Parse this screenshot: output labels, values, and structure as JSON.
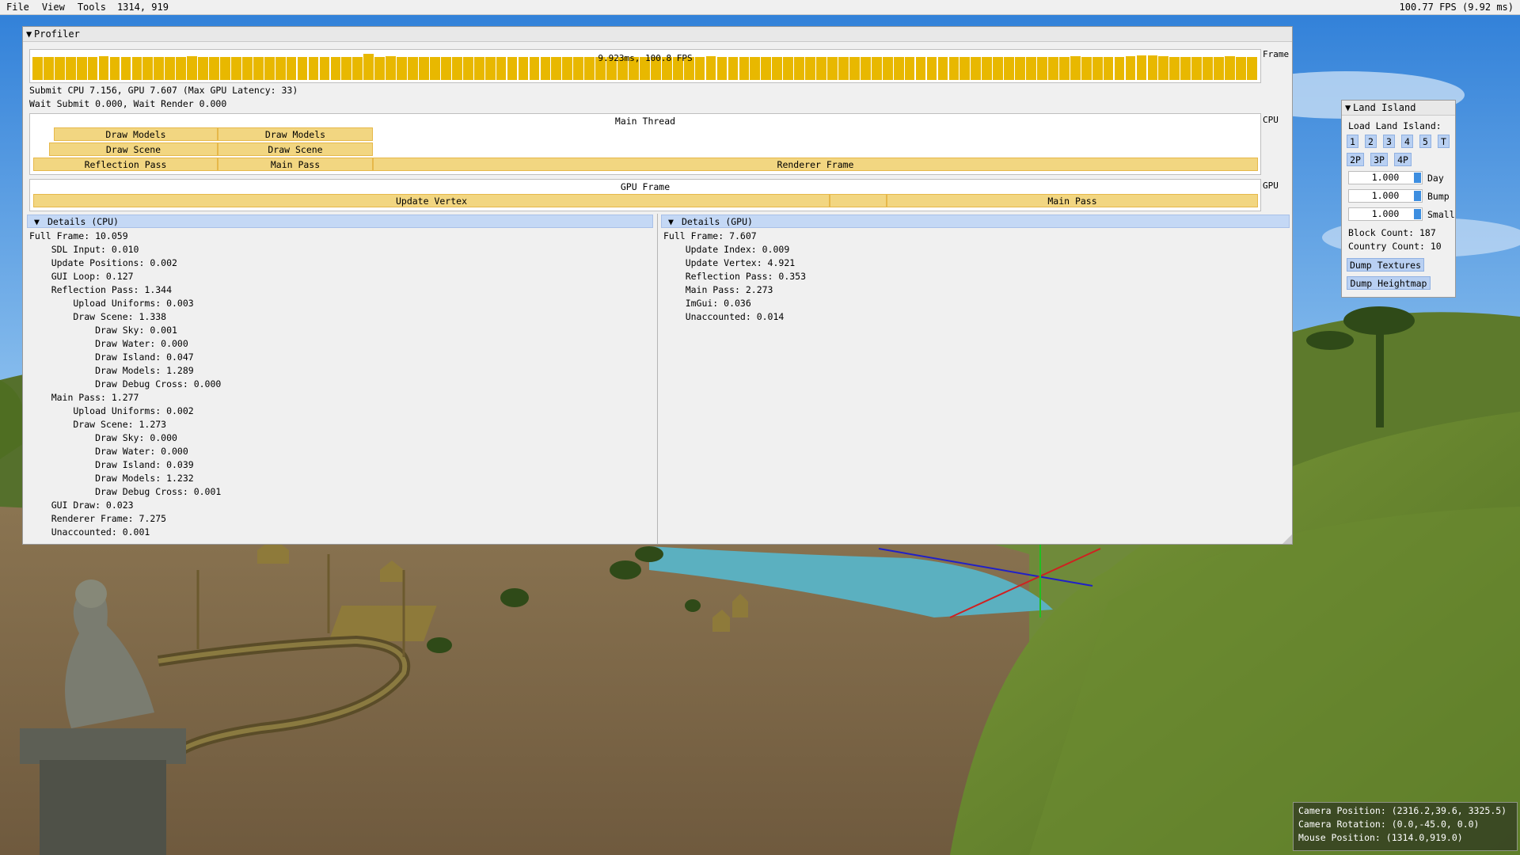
{
  "menu": {
    "items": [
      "File",
      "View",
      "Tools"
    ],
    "mouse_coord": "1314, 919",
    "fps": "100.77 FPS (9.92 ms)"
  },
  "profiler": {
    "title": "Profiler",
    "frame_graph": {
      "label": "9.923ms, 100.8 FPS",
      "side_label": "Frame",
      "bar_color": "#e8b800",
      "bar_levels": [
        0.8,
        0.8,
        0.8,
        0.8,
        0.8,
        0.8,
        0.82,
        0.8,
        0.8,
        0.8,
        0.8,
        0.8,
        0.8,
        0.8,
        0.84,
        0.8,
        0.8,
        0.8,
        0.8,
        0.8,
        0.8,
        0.8,
        0.8,
        0.8,
        0.8,
        0.8,
        0.8,
        0.8,
        0.8,
        0.8,
        0.92,
        0.8,
        0.84,
        0.8,
        0.8,
        0.8,
        0.8,
        0.8,
        0.8,
        0.8,
        0.8,
        0.8,
        0.8,
        0.8,
        0.8,
        0.8,
        0.8,
        0.8,
        0.8,
        0.8,
        0.8,
        0.8,
        0.8,
        0.8,
        0.8,
        0.8,
        0.8,
        0.8,
        0.8,
        0.8,
        0.8,
        0.82,
        0.8,
        0.8,
        0.8,
        0.8,
        0.8,
        0.8,
        0.8,
        0.8,
        0.8,
        0.8,
        0.8,
        0.8,
        0.8,
        0.8,
        0.8,
        0.8,
        0.8,
        0.8,
        0.8,
        0.8,
        0.8,
        0.8,
        0.8,
        0.8,
        0.8,
        0.8,
        0.8,
        0.8,
        0.8,
        0.8,
        0.8,
        0.8,
        0.84,
        0.8,
        0.8,
        0.8,
        0.8,
        0.82,
        0.86,
        0.86,
        0.84,
        0.8,
        0.8,
        0.8,
        0.8,
        0.8,
        0.84,
        0.8,
        0.8
      ]
    },
    "submit_line": "Submit CPU 7.156, GPU 7.607 (Max GPU Latency: 33)",
    "wait_line": "Wait Submit 0.000, Wait Render 0.000",
    "cpu_track": {
      "title": "Main Thread",
      "side_label": "CPU",
      "blocks": {
        "draw_models_1": "Draw Models",
        "draw_models_2": "Draw Models",
        "draw_scene_1": "Draw Scene",
        "draw_scene_2": "Draw Scene",
        "reflection_pass": "Reflection Pass",
        "main_pass": "Main Pass",
        "renderer_frame": "Renderer Frame"
      }
    },
    "gpu_track": {
      "title": "GPU Frame",
      "side_label": "GPU",
      "blocks": {
        "update_vertex": "Update Vertex",
        "main_pass": "Main Pass"
      }
    },
    "details_cpu": {
      "header": "Details (CPU)",
      "lines": [
        "Full Frame: 10.059",
        "    SDL Input: 0.010",
        "    Update Positions: 0.002",
        "    GUI Loop: 0.127",
        "    Reflection Pass: 1.344",
        "        Upload Uniforms: 0.003",
        "        Draw Scene: 1.338",
        "            Draw Sky: 0.001",
        "            Draw Water: 0.000",
        "            Draw Island: 0.047",
        "            Draw Models: 1.289",
        "            Draw Debug Cross: 0.000",
        "    Main Pass: 1.277",
        "        Upload Uniforms: 0.002",
        "        Draw Scene: 1.273",
        "            Draw Sky: 0.000",
        "            Draw Water: 0.000",
        "            Draw Island: 0.039",
        "            Draw Models: 1.232",
        "            Draw Debug Cross: 0.001",
        "    GUI Draw: 0.023",
        "    Renderer Frame: 7.275",
        "    Unaccounted: 0.001"
      ]
    },
    "details_gpu": {
      "header": "Details (GPU)",
      "lines": [
        "Full Frame: 7.607",
        "    Update Index: 0.009",
        "    Update Vertex: 4.921",
        "    Reflection Pass: 0.353",
        "    Main Pass: 2.273",
        "    ImGui: 0.036",
        "    Unaccounted: 0.014"
      ]
    }
  },
  "land_island": {
    "title": "Land Island",
    "load_label": "Load Land Island:",
    "island_buttons": [
      "1",
      "2",
      "3",
      "4",
      "5",
      "T"
    ],
    "player_buttons": [
      "2P",
      "3P",
      "4P"
    ],
    "sliders": [
      {
        "value": "1.000",
        "label": "Day"
      },
      {
        "value": "1.000",
        "label": "Bump"
      },
      {
        "value": "1.000",
        "label": "Small"
      }
    ],
    "block_count": "Block Count: 187",
    "country_count": "Country Count: 10",
    "dump_textures": "Dump Textures",
    "dump_heightmap": "Dump Heightmap"
  },
  "camera_info": {
    "position": "Camera Position: (2316.2,39.6, 3325.5)",
    "rotation": "Camera Rotation: (0.0,-45.0, 0.0)",
    "mouse": "Mouse Position: (1314.0,919.0)"
  },
  "colors": {
    "menu_bg": "#f0f0f0",
    "window_bg": "#f0f0f0",
    "block_fill": "#f2d681",
    "section_header": "#c4d8f5",
    "button": "#b9d0f2",
    "slider_grab": "#3d8ee0",
    "sky": "#4a9be6",
    "grass": "#6f8a3a",
    "dirt": "#8c7a5a",
    "water": "#5bb0c0"
  }
}
